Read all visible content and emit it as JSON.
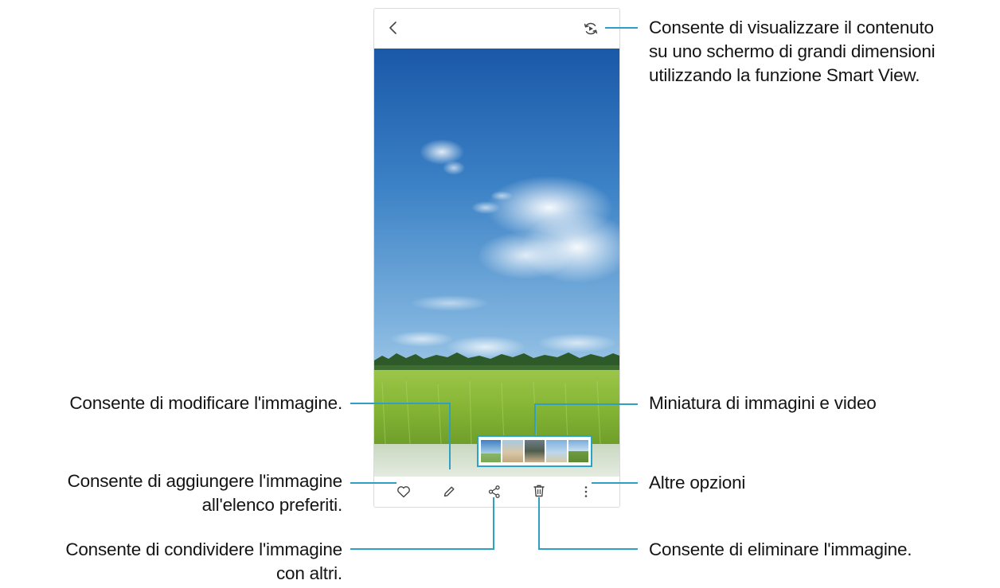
{
  "colors": {
    "leader_line": "#2f9fc4",
    "thumbnail_border": "#29a3c9",
    "icon": "#444444",
    "sky_top": "#1f5fae",
    "sky_bottom": "#cfe4f3",
    "field": "#8fbf3a"
  },
  "screen": {
    "top_bar": {
      "back_icon": "chevron-left-icon",
      "smart_view_icon": "smart-view-icon"
    },
    "thumbnail_strip": {
      "count": 5
    },
    "bottom_bar": {
      "icons": [
        "heart-icon",
        "pencil-icon",
        "share-icon",
        "trash-icon",
        "more-vertical-icon"
      ]
    }
  },
  "callouts": {
    "smart_view": {
      "line1": "Consente di visualizzare il contenuto",
      "line2": "su uno schermo di grandi dimensioni",
      "line3": "utilizzando la funzione Smart View."
    },
    "edit": "Consente di modificare l'immagine.",
    "thumbnails": "Miniatura di immagini e video",
    "favorite": {
      "line1": "Consente di aggiungere l'immagine",
      "line2": "all'elenco preferiti."
    },
    "more": "Altre opzioni",
    "share": {
      "line1": "Consente di condividere l'immagine",
      "line2": "con altri."
    },
    "delete": "Consente di eliminare l'immagine."
  }
}
